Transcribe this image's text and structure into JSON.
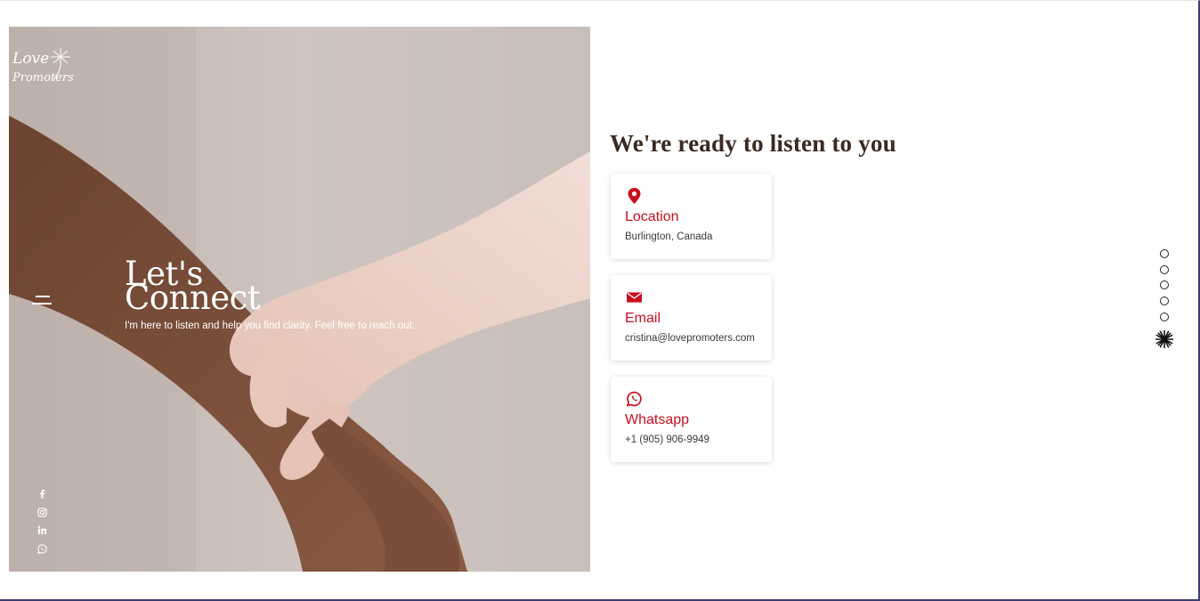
{
  "brand": {
    "logo_line1": "Love",
    "logo_line2": "Promoters"
  },
  "hero": {
    "title_line1": "Let's",
    "title_line2": "Connect",
    "subtitle": "I'm here to listen and help you find clarity. Feel free to reach out."
  },
  "social": [
    {
      "icon": "facebook-icon"
    },
    {
      "icon": "instagram-icon"
    },
    {
      "icon": "linkedin-icon"
    },
    {
      "icon": "whatsapp-icon"
    }
  ],
  "contact": {
    "heading": "We're ready to listen to you",
    "cards": [
      {
        "icon": "location-pin-icon",
        "title": "Location",
        "value": "Burlington, Canada"
      },
      {
        "icon": "envelope-icon",
        "title": "Email",
        "value": "cristina@lovepromoters.com"
      },
      {
        "icon": "whatsapp-icon",
        "title": "Whatsapp",
        "value": "+1 (905) 906-9949"
      }
    ]
  },
  "colors": {
    "accent": "#c8101e",
    "heading": "#3a2a22",
    "text": "#3a3a3a"
  },
  "page_nav": {
    "dot_count": 5,
    "active_icon": "dandelion-icon"
  }
}
